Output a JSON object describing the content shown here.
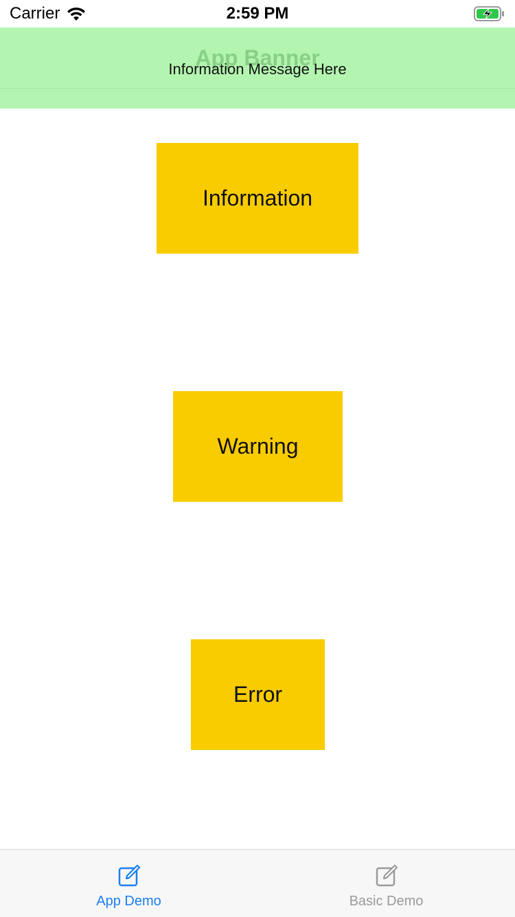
{
  "status_bar": {
    "carrier": "Carrier",
    "time": "2:59 PM",
    "wifi_icon": "wifi-icon",
    "battery_icon": "battery-charging-icon"
  },
  "banner": {
    "title": "App Banner",
    "message": "Information Message Here",
    "background": "#b3f5b0"
  },
  "buttons": {
    "information": "Information",
    "warning": "Warning",
    "error": "Error",
    "color": "#f9cc00"
  },
  "tab_bar": {
    "tabs": [
      {
        "label": "App Demo",
        "icon": "compose-icon",
        "selected": true,
        "color": "#1a7ff0"
      },
      {
        "label": "Basic Demo",
        "icon": "compose-icon",
        "selected": false,
        "color": "#9a9a9a"
      }
    ]
  }
}
